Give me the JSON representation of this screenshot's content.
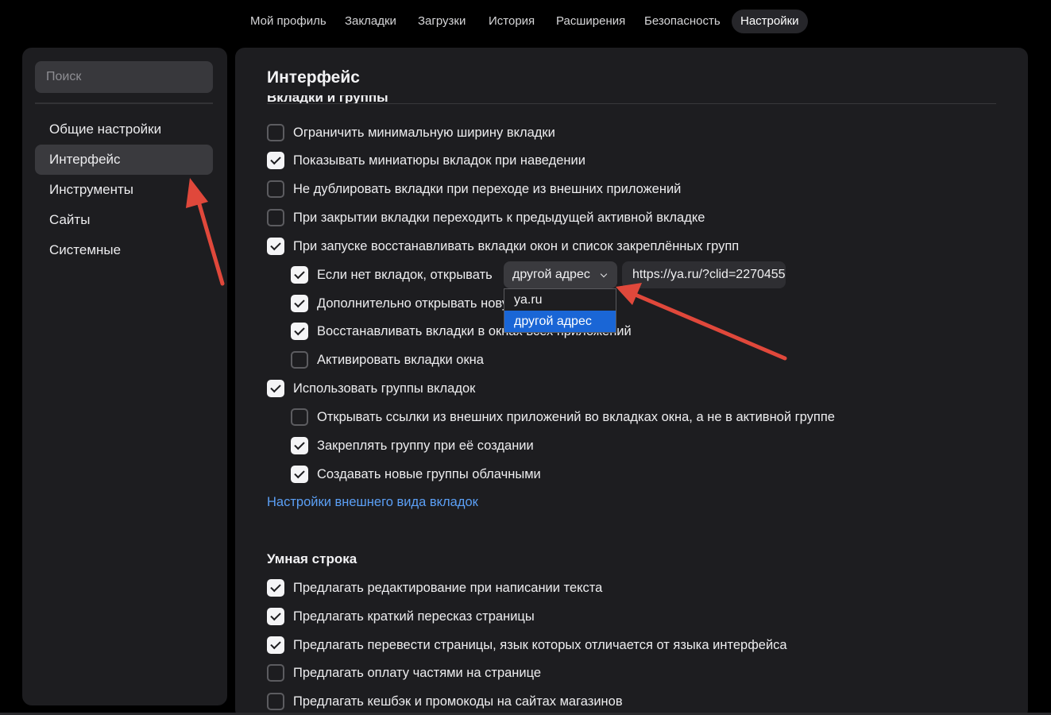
{
  "topnav": {
    "items": [
      "Мой профиль",
      "Закладки",
      "Загрузки",
      "История",
      "Расширения",
      "Безопасность",
      "Настройки"
    ],
    "active_index": 6
  },
  "sidebar": {
    "search_placeholder": "Поиск",
    "items": [
      {
        "label": "Общие настройки",
        "active": false
      },
      {
        "label": "Интерфейс",
        "active": true
      },
      {
        "label": "Инструменты",
        "active": false
      },
      {
        "label": "Сайты",
        "active": false
      },
      {
        "label": "Системные",
        "active": false
      }
    ]
  },
  "main": {
    "title": "Интерфейс",
    "clipped_section": "Вкладки и группы",
    "tabs_options": [
      {
        "label": "Ограничить минимальную ширину вкладки",
        "checked": false,
        "level": 0
      },
      {
        "label": "Показывать миниатюры вкладок при наведении",
        "checked": true,
        "level": 0
      },
      {
        "label": "Не дублировать вкладки при переходе из внешних приложений",
        "checked": false,
        "level": 0
      },
      {
        "label": "При закрытии вкладки переходить к предыдущей активной вкладке",
        "checked": false,
        "level": 0
      },
      {
        "label": "При запуске восстанавливать вкладки окон и список закреплённых групп",
        "checked": true,
        "level": 0
      },
      {
        "label": "Если нет вкладок, открывать",
        "checked": true,
        "level": 1
      },
      {
        "label": "Дополнительно открывать новую вкладку",
        "checked": true,
        "level": 1
      },
      {
        "label": "Восстанавливать вкладки в окнах всех приложений",
        "checked": true,
        "level": 1
      },
      {
        "label": "Активировать вкладки окна",
        "checked": false,
        "level": 1
      },
      {
        "label": "Использовать группы вкладок",
        "checked": true,
        "level": 0
      },
      {
        "label": "Открывать ссылки из внешних приложений во вкладках окна, а не в активной группе",
        "checked": false,
        "level": 1
      },
      {
        "label": "Закреплять группу при её создании",
        "checked": true,
        "level": 1
      },
      {
        "label": "Создавать новые группы облачными",
        "checked": true,
        "level": 1
      }
    ],
    "open_dropdown": {
      "value": "другой адрес",
      "options": [
        "ya.ru",
        "другой адрес"
      ],
      "selected_index": 1
    },
    "url_value": "https://ya.ru/?clid=2270455",
    "appearance_link": "Настройки внешнего вида вкладок",
    "smartbar": {
      "heading": "Умная строка",
      "options": [
        {
          "label": "Предлагать редактирование при написании текста",
          "checked": true
        },
        {
          "label": "Предлагать краткий пересказ страницы",
          "checked": true
        },
        {
          "label": "Предлагать перевести страницы, язык которых отличается от языка интерфейса",
          "checked": true
        },
        {
          "label": "Предлагать оплату частями на странице",
          "checked": false
        },
        {
          "label": "Предлагать кешбэк и промокоды на сайтах магазинов",
          "checked": false
        }
      ]
    }
  },
  "annotation_color": "#e0483b"
}
